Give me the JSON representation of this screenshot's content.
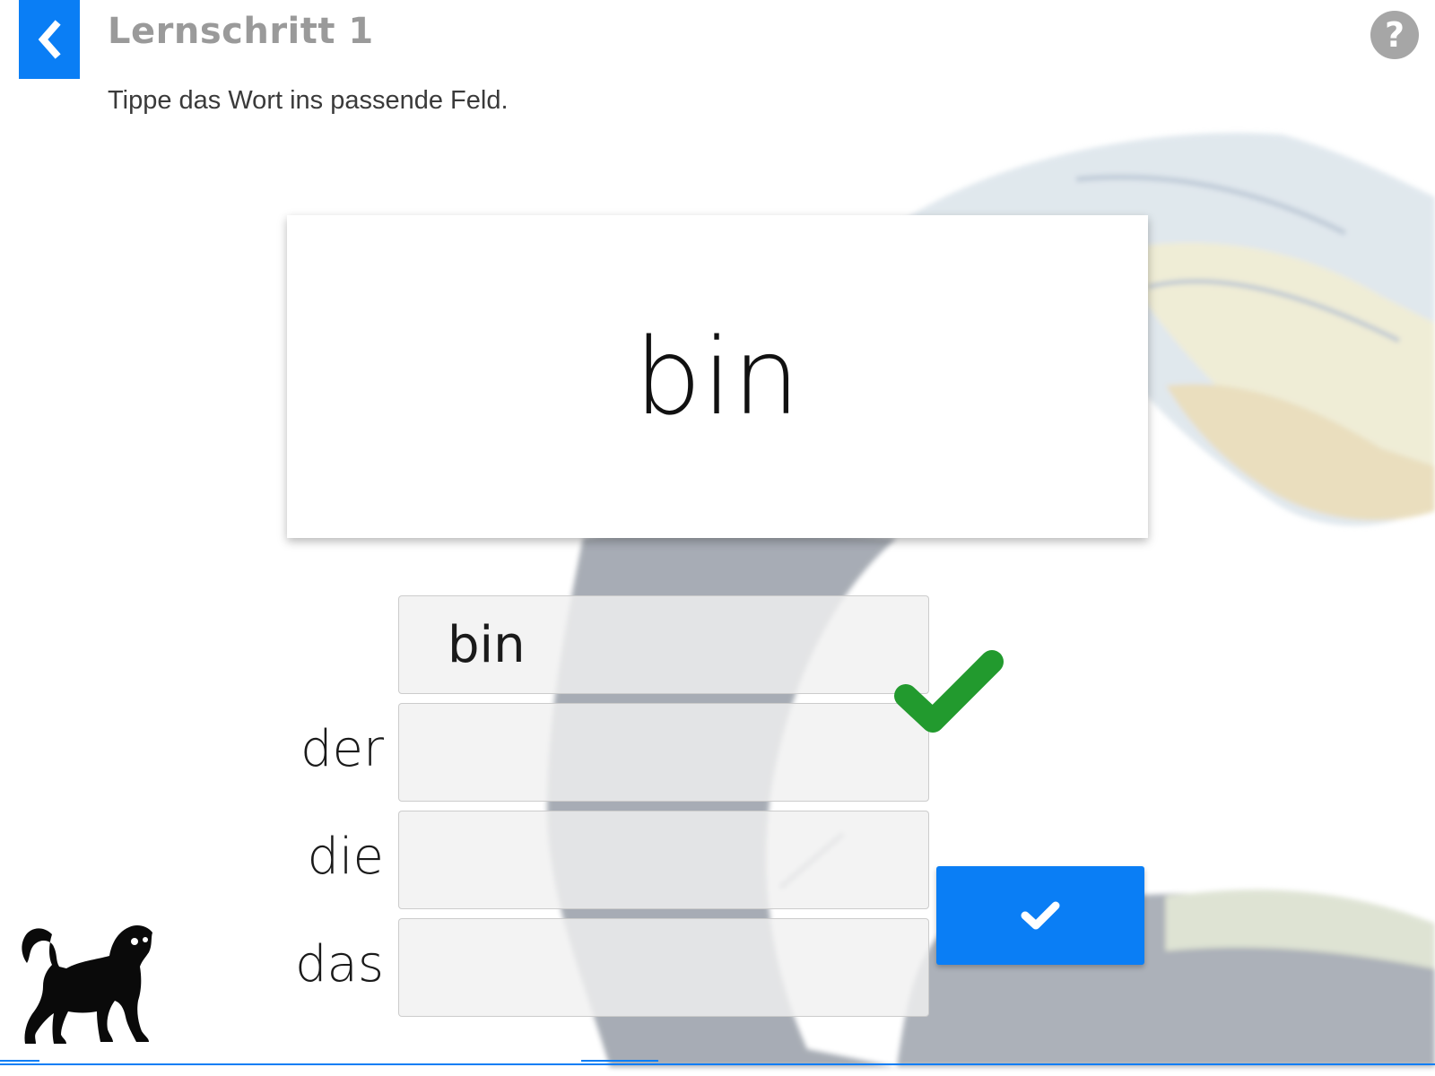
{
  "header": {
    "title": "Lernschritt 1",
    "instruction": "Tippe das Wort ins passende Feld.",
    "back_icon": "chevron-left-icon",
    "help_icon": "help-icon",
    "help_glyph": "?"
  },
  "card": {
    "word": "bin"
  },
  "answer_rows": [
    {
      "label": "",
      "value": "bin"
    },
    {
      "label": "der",
      "value": ""
    },
    {
      "label": "die",
      "value": ""
    },
    {
      "label": "das",
      "value": ""
    }
  ],
  "feedback": {
    "icon": "checkmark-icon",
    "status": "correct",
    "color": "#229a2e"
  },
  "submit": {
    "icon": "check-icon"
  },
  "mascot": {
    "icon": "dog-icon"
  },
  "colors": {
    "accent": "#0a7ef5",
    "title": "#9a9a9a",
    "help": "#a6a6a6",
    "correct": "#229a2e"
  }
}
